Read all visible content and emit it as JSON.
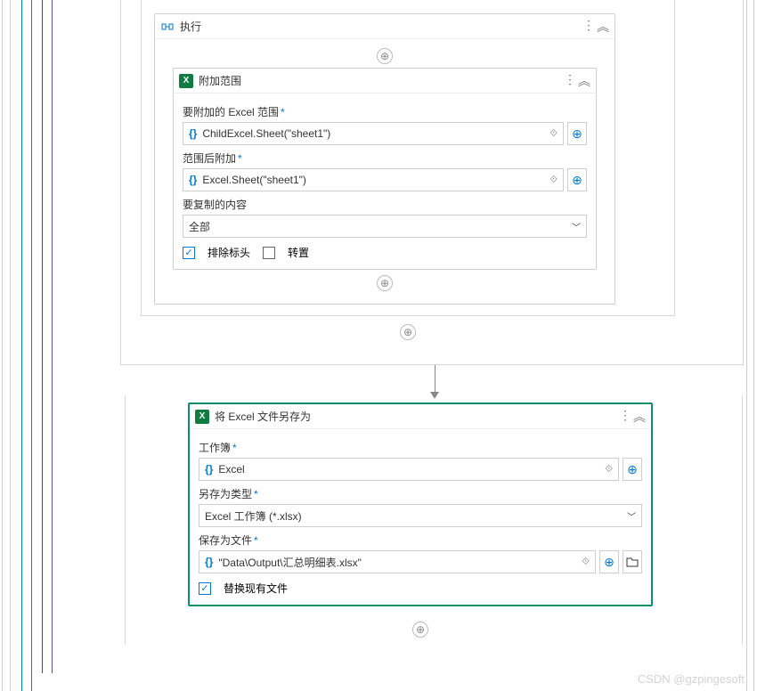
{
  "exec": {
    "title": "执行"
  },
  "append": {
    "title": "附加范围",
    "field1_label": "要附加的 Excel 范围",
    "field1_value": "ChildExcel.Sheet(\"sheet1\")",
    "field2_label": "范围后附加",
    "field2_value": "Excel.Sheet(\"sheet1\")",
    "field3_label": "要复制的内容",
    "field3_value": "全部",
    "chk1_label": "排除标头",
    "chk2_label": "转置"
  },
  "save": {
    "title": "将 Excel 文件另存为",
    "field1_label": "工作簿",
    "field1_value": "Excel",
    "field2_label": "另存为类型",
    "field2_value": "Excel 工作簿 (*.xlsx)",
    "field3_label": "保存为文件",
    "field3_value": "\"Data\\Output\\汇总明细表.xlsx\"",
    "chk1_label": "替换现有文件"
  },
  "watermark": "CSDN @gzpingesoft"
}
